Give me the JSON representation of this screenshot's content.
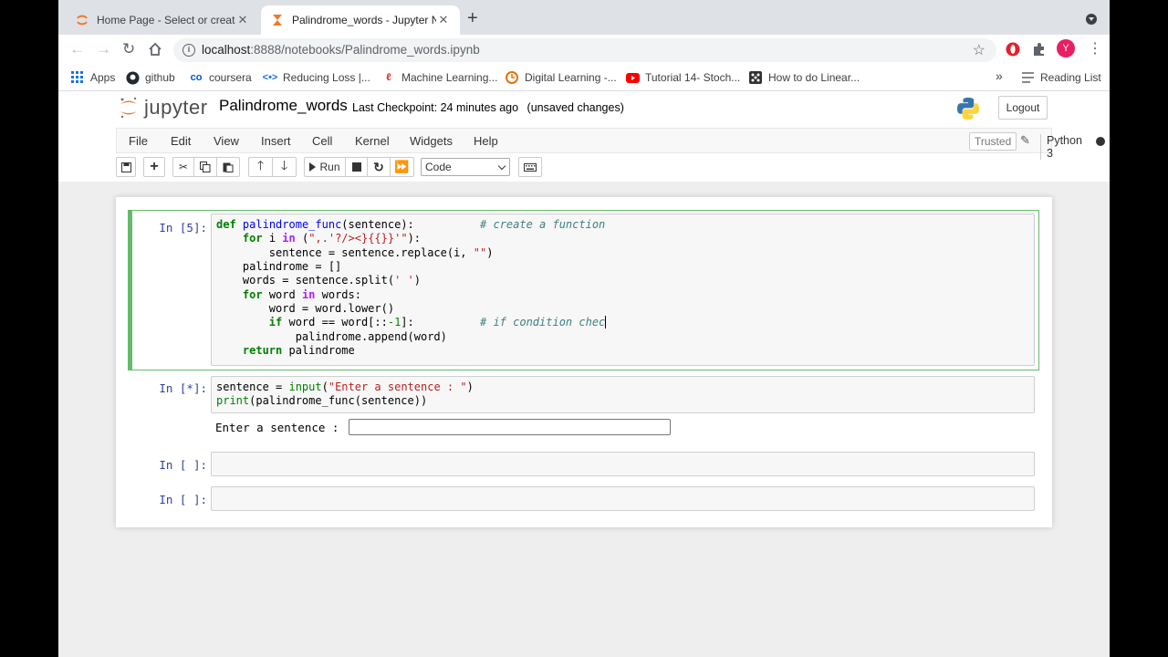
{
  "browser": {
    "tabs": [
      {
        "title": "Home Page - Select or create a",
        "icon": "jupyter-icon",
        "active": false
      },
      {
        "title": "Palindrome_words - Jupyter No",
        "icon": "hourglass-icon",
        "active": true
      }
    ],
    "new_tab": "+",
    "url_host": "localhost",
    "url_rest": ":8888/notebooks/Palindrome_words.ipynb",
    "bookmarks": [
      {
        "label": "Apps",
        "icon": "apps-grid-icon"
      },
      {
        "label": "github",
        "icon": "github-icon"
      },
      {
        "label": "coursera",
        "icon": "coursera-icon"
      },
      {
        "label": "Reducing Loss  |...",
        "icon": "code-icon"
      },
      {
        "label": "Machine Learning...",
        "icon": "ml-icon"
      },
      {
        "label": "Digital Learning -...",
        "icon": "clock-icon"
      },
      {
        "label": "Tutorial 14- Stoch...",
        "icon": "youtube-icon"
      },
      {
        "label": "How to do Linear...",
        "icon": "dice-icon"
      }
    ],
    "more": "»",
    "reading_list": "Reading List",
    "profile_initial": "Y"
  },
  "jupyter": {
    "logo_text": "jupyter",
    "notebook_name": "Palindrome_words",
    "checkpoint": "Last Checkpoint: 24 minutes ago",
    "unsaved": "(unsaved changes)",
    "logout": "Logout",
    "menu": [
      "File",
      "Edit",
      "View",
      "Insert",
      "Cell",
      "Kernel",
      "Widgets",
      "Help"
    ],
    "trusted": "Trusted",
    "kernel": "Python 3",
    "run_label": "Run",
    "cell_type": "Code"
  },
  "cells": [
    {
      "prompt": "In [5]:"
    },
    {
      "prompt": "In [*]:",
      "stdin_label": "Enter a sentence : "
    },
    {
      "prompt": "In [ ]:"
    },
    {
      "prompt": "In [ ]:"
    }
  ],
  "colors": {
    "selected_cell": "#66bb6a",
    "prompt": "#303f9f",
    "keyword": "#008000",
    "comment": "#408080",
    "string": "#ba2121"
  }
}
